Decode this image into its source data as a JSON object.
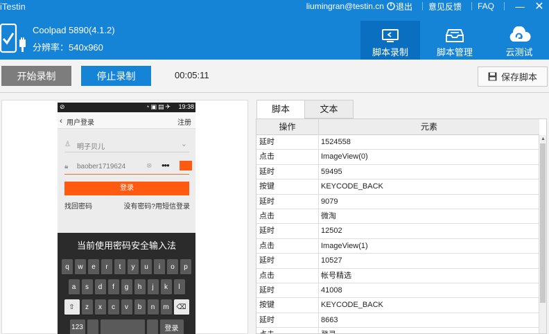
{
  "app": {
    "title": "iTestin"
  },
  "top": {
    "user": "liumingran@testin.cn",
    "logout": "退出",
    "feedback": "意见反馈",
    "faq": "FAQ",
    "minimize": "—",
    "close": "✕"
  },
  "device": {
    "name": "Coolpad 5890(4.1.2)",
    "resolution": "分辨率：540x960"
  },
  "nav": {
    "record": "脚本录制",
    "manage": "脚本管理",
    "cloud": "云测试"
  },
  "toolbar": {
    "start": "开始录制",
    "stop": "停止录制",
    "timer": "00:05:11",
    "save": "保存脚本"
  },
  "phone": {
    "time": "19:38",
    "page_title": "用户登录",
    "register": "注册",
    "username": "明子贝儿",
    "password": "baober1719624",
    "password_dots": "•••",
    "login": "登录",
    "forgot": "找回密码",
    "sms_login": "没有密码?用短信登录",
    "kb_title": "当前使用密码安全输入法",
    "kb_row1": [
      "q",
      "w",
      "e",
      "r",
      "t",
      "y",
      "u",
      "i",
      "o",
      "p"
    ],
    "kb_row2": [
      "a",
      "s",
      "d",
      "f",
      "g",
      "h",
      "j",
      "k",
      "l"
    ],
    "kb_row3": [
      "z",
      "x",
      "c",
      "v",
      "b",
      "n",
      "m"
    ],
    "kb_num": "123",
    "kb_done": "登录"
  },
  "script": {
    "tab_script": "脚本",
    "tab_text": "文本",
    "col_op": "操作",
    "col_el": "元素",
    "rows": [
      {
        "op": "延时",
        "el": "1524558"
      },
      {
        "op": "点击",
        "el": "ImageView(0)"
      },
      {
        "op": "延时",
        "el": "59495"
      },
      {
        "op": "按键",
        "el": "KEYCODE_BACK"
      },
      {
        "op": "延时",
        "el": "9079"
      },
      {
        "op": "点击",
        "el": "微淘"
      },
      {
        "op": "延时",
        "el": "12502"
      },
      {
        "op": "点击",
        "el": "ImageView(1)"
      },
      {
        "op": "延时",
        "el": "10527"
      },
      {
        "op": "点击",
        "el": "帐号精选"
      },
      {
        "op": "延时",
        "el": "41008"
      },
      {
        "op": "按键",
        "el": "KEYCODE_BACK"
      },
      {
        "op": "延时",
        "el": "8663"
      },
      {
        "op": "点击",
        "el": "登录"
      }
    ]
  },
  "colors": {
    "brand": "#1583d6",
    "brand_dark": "#0a6fc0",
    "accent": "#ff5a10"
  }
}
